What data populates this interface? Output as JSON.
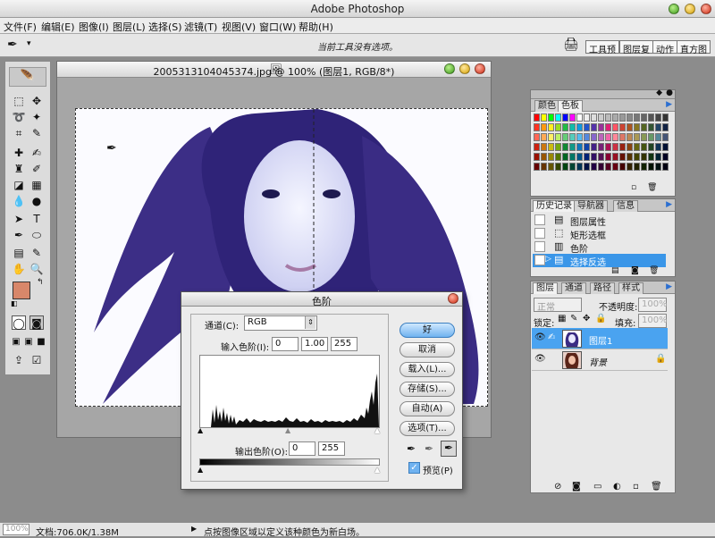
{
  "app_title": "Adobe Photoshop",
  "menu": [
    "文件(F)",
    "编辑(E)",
    "图像(I)",
    "图层(L)",
    "选择(S)",
    "滤镜(T)",
    "视图(V)",
    "窗口(W)",
    "帮助(H)"
  ],
  "options_bar": {
    "hint": "当前工具没有选项。",
    "palette_tabs": [
      "工具预",
      "图层复",
      "动作",
      "直方图"
    ]
  },
  "document": {
    "title": "2005313104045374.jpg @ 100% (图层1, RGB/8*)"
  },
  "swatches_panel": {
    "tabs": [
      "颜色",
      "色板"
    ]
  },
  "history_panel": {
    "tabs": [
      "历史记录",
      "导航器",
      "信息"
    ],
    "items": [
      "图层属性",
      "矩形选框",
      "色阶",
      "选择反选"
    ],
    "selected_index": 3
  },
  "layers_panel": {
    "tabs": [
      "图层",
      "通道",
      "路径",
      "样式"
    ],
    "blend_mode": "正常",
    "opacity_label": "不透明度:",
    "opacity_value": "100%",
    "lock_label": "锁定:",
    "fill_label": "填充:",
    "fill_value": "100%",
    "layers": [
      {
        "name": "图层1",
        "selected": true
      },
      {
        "name": "背景",
        "selected": false
      }
    ]
  },
  "levels_dialog": {
    "title": "色阶",
    "channel_label": "通道(C):",
    "channel_value": "RGB",
    "input_label": "输入色阶(I):",
    "input_values": [
      "0",
      "1.00",
      "255"
    ],
    "output_label": "输出色阶(O):",
    "output_values": [
      "0",
      "255"
    ],
    "buttons": [
      "好",
      "取消",
      "载入(L)...",
      "存储(S)...",
      "自动(A)",
      "选项(T)..."
    ],
    "preview_label": "预览(P)",
    "preview_checked": true
  },
  "status_bar": {
    "zoom": "100%",
    "doc_size": "文档:706.0K/1.38M",
    "message": "点按图像区域以定义该种颜色为新白场。"
  },
  "colors": {
    "foreground": "#d8876a",
    "background": "#ffffff",
    "selection_blue": "#3a96e8"
  }
}
